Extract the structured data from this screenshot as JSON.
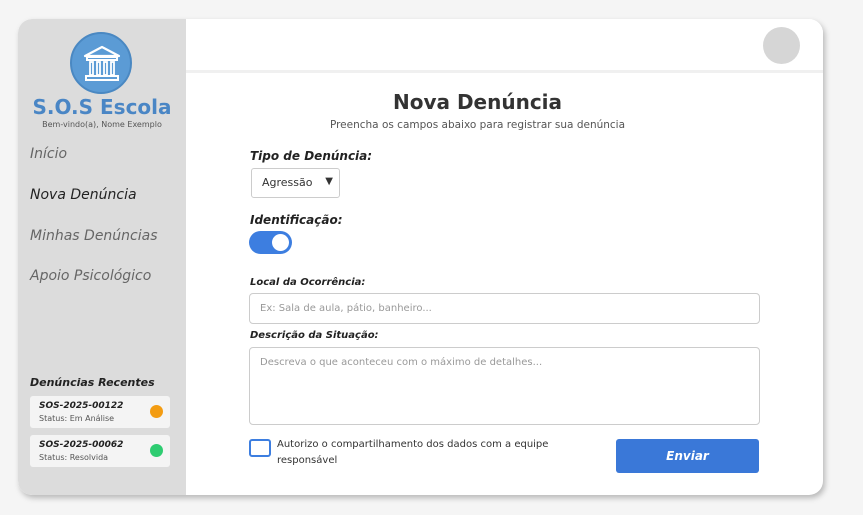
{
  "sidebar": {
    "brand": "S.O.S Escola",
    "welcome": "Bem-vindo(a), Nome Exemplo",
    "nav": [
      "Início",
      "Nova Denúncia",
      "Minhas Denúncias",
      "Apoio Psicológico"
    ],
    "recent_title": "Denúncias Recentes",
    "recent": [
      {
        "code": "SOS-2025-00122",
        "status": "Status: Em Análise",
        "color": "#f39c12"
      },
      {
        "code": "SOS-2025-00062",
        "status": "Status: Resolvida",
        "color": "#2ecc71"
      }
    ]
  },
  "form": {
    "title": "Nova Denúncia",
    "subtitle": "Preencha os campos abaixo para registrar sua denúncia",
    "type_label": "Tipo de Denúncia:",
    "type_value": "Agressão",
    "identification_label": "Identificação:",
    "identification_on": true,
    "location_label": "Local da Ocorrência:",
    "location_placeholder": "Ex: Sala de aula, pátio, banheiro...",
    "description_label": "Descrição da Situação:",
    "description_placeholder": "Descreva o que aconteceu com o máximo de detalhes...",
    "consent_text": "Autorizo o compartilhamento dos dados com a equipe responsável",
    "submit_label": "Enviar"
  },
  "colors": {
    "accent": "#3a78d8",
    "brand": "#4a86c5",
    "sidebar_bg": "#dcdcdc"
  }
}
